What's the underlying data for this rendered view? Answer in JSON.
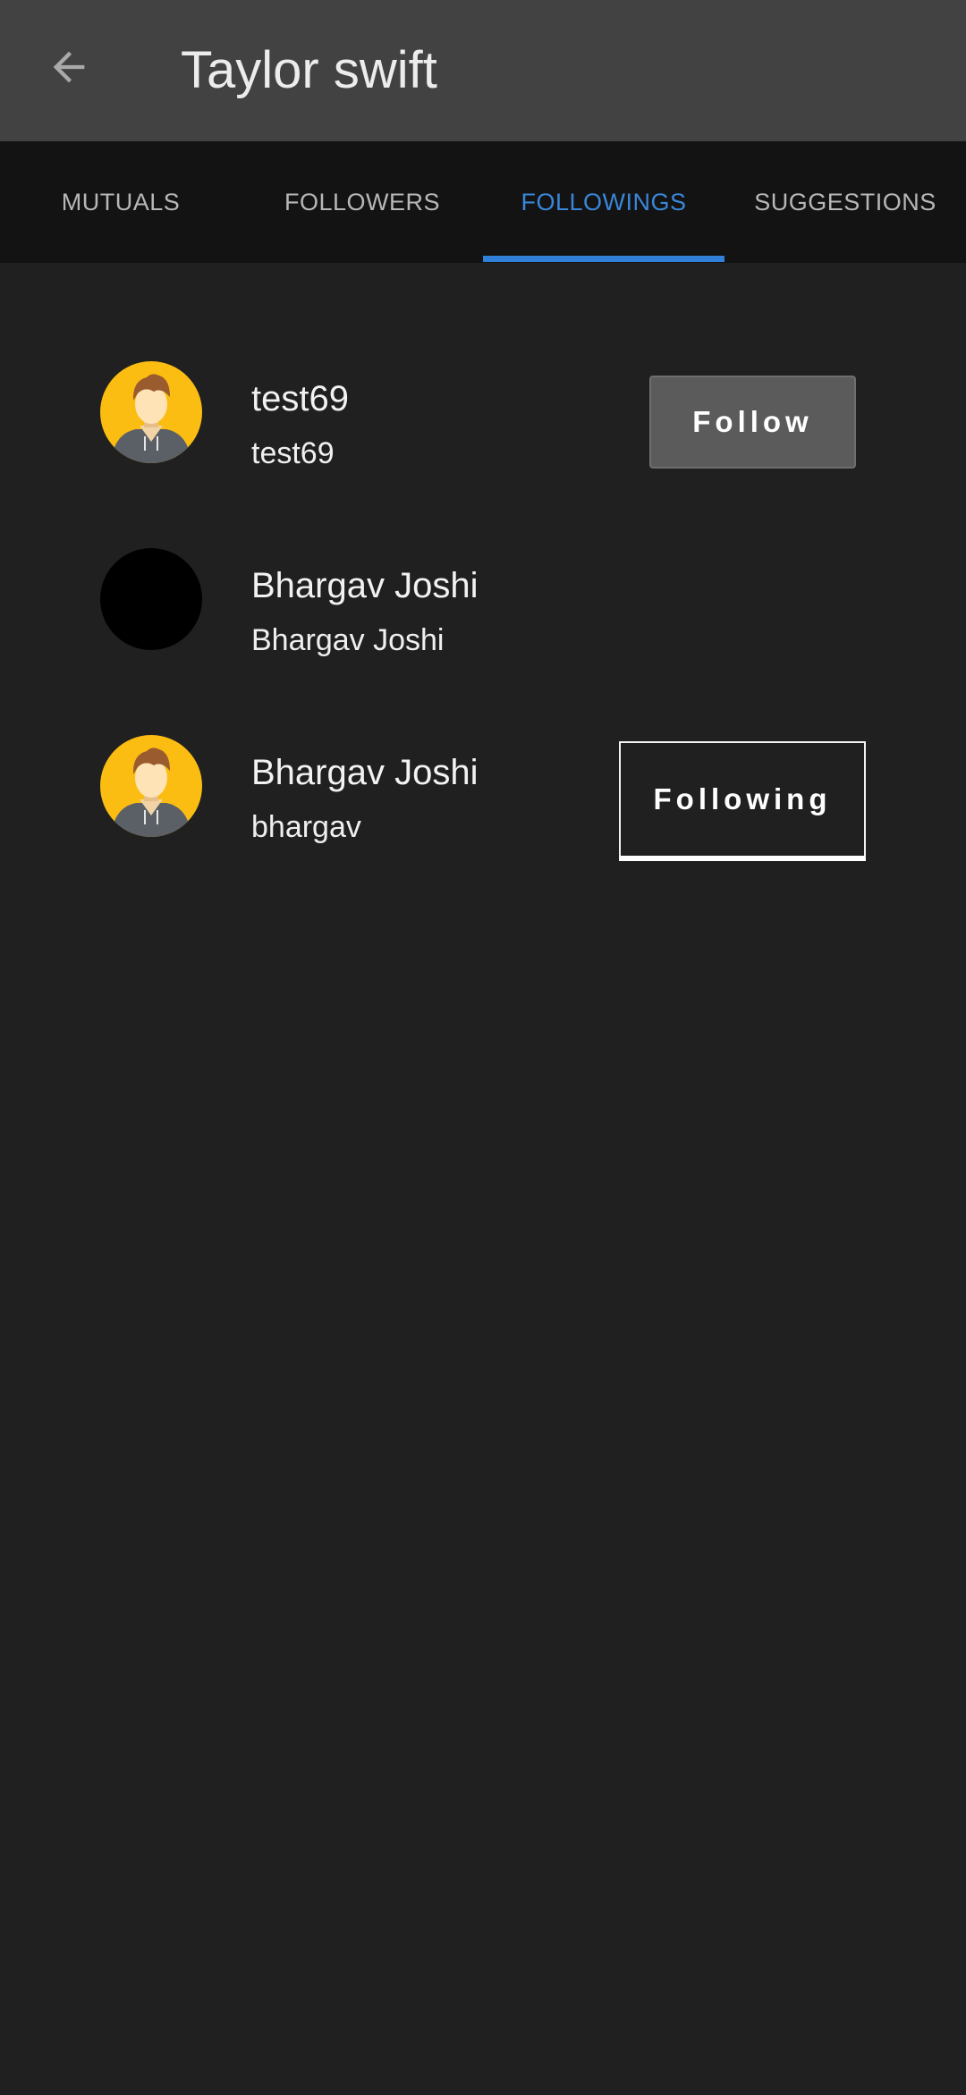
{
  "app_bar": {
    "back_icon": "arrow-left-icon",
    "title": "Taylor swift"
  },
  "tabs": [
    {
      "label": "MUTUALS",
      "active": false
    },
    {
      "label": "FOLLOWERS",
      "active": false
    },
    {
      "label": "FOLLOWINGS",
      "active": true
    },
    {
      "label": "SUGGESTIONS",
      "active": false
    }
  ],
  "users": [
    {
      "name": "test69",
      "username": "test69",
      "avatar": "default-user-avatar",
      "action": "Follow"
    },
    {
      "name": "Bhargav Joshi",
      "username": "Bhargav Joshi",
      "avatar": "blank-black-avatar",
      "action": ""
    },
    {
      "name": "Bhargav Joshi",
      "username": "bhargav",
      "avatar": "default-user-avatar",
      "action": "Following"
    }
  ],
  "colors": {
    "app_bar": "#424242",
    "tab_bar": "#131313",
    "background": "#202020",
    "accent": "#2f80d6",
    "avatar_yellow": "#fbbd12",
    "follow_button": "#5b5b5b"
  }
}
